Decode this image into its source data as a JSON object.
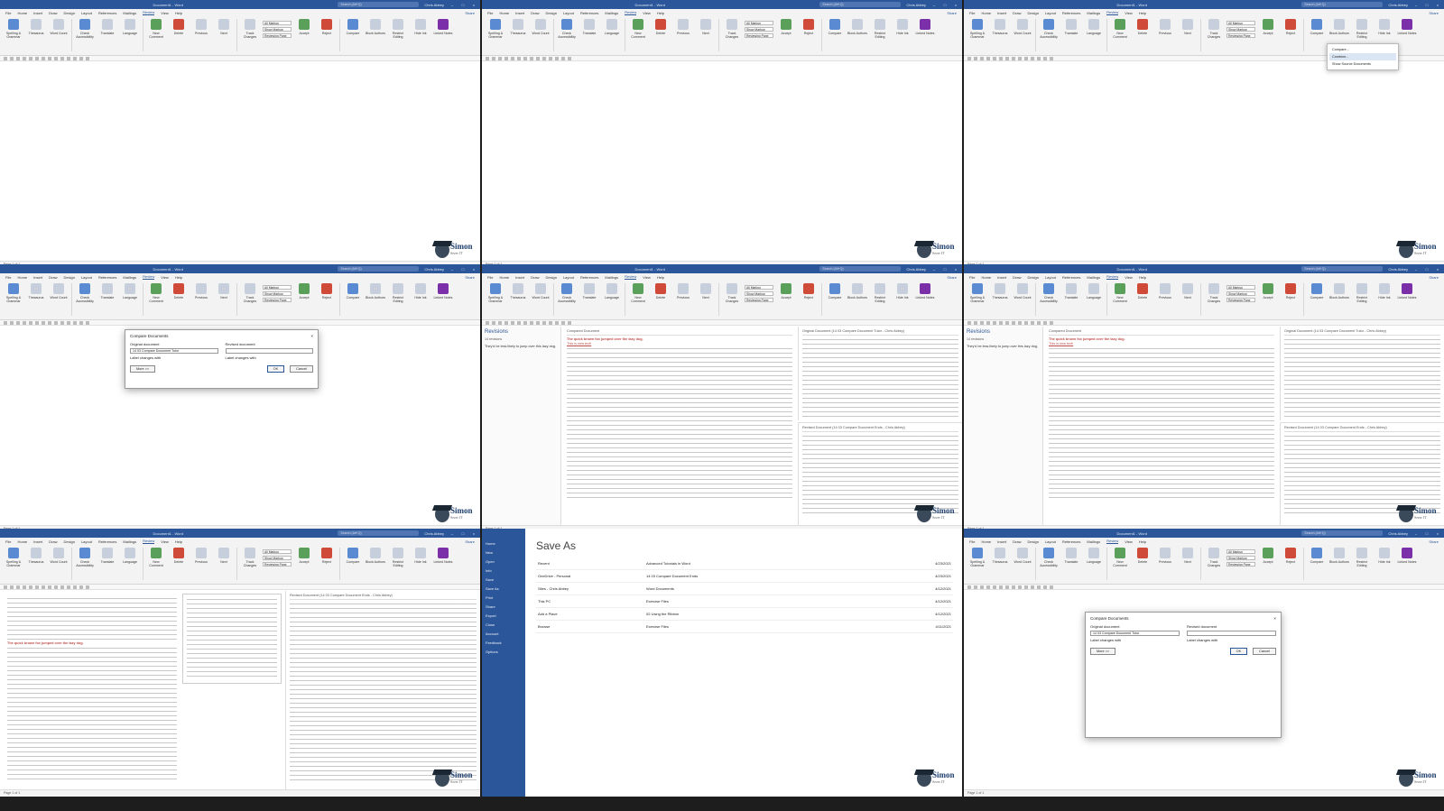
{
  "app": {
    "title": "Word",
    "doc_title": "Document1 - Word",
    "search_placeholder": "Search (Alt+Q)",
    "user": "Chris Abbey",
    "share_label": "Share",
    "brand_color": "#2b579a",
    "status": "Page 1 of 1",
    "menu": [
      "File",
      "Home",
      "Insert",
      "Draw",
      "Design",
      "Layout",
      "References",
      "Mailings",
      "Review",
      "View",
      "Help"
    ],
    "active_tab": "Review"
  },
  "ribbon": {
    "buttons": [
      {
        "label": "Spelling & Grammar",
        "icon": "spelling-icon",
        "tone": "blue"
      },
      {
        "label": "Thesaurus",
        "icon": "thesaurus-icon",
        "tone": ""
      },
      {
        "label": "Word Count",
        "icon": "word-count-icon",
        "tone": ""
      },
      {
        "label": "Check Accessibility",
        "icon": "accessibility-icon",
        "tone": "blue"
      },
      {
        "label": "Translate",
        "icon": "translate-icon",
        "tone": ""
      },
      {
        "label": "Language",
        "icon": "language-icon",
        "tone": ""
      },
      {
        "label": "New Comment",
        "icon": "new-comment-icon",
        "tone": "green"
      },
      {
        "label": "Delete",
        "icon": "delete-icon",
        "tone": "red"
      },
      {
        "label": "Previous",
        "icon": "previous-icon",
        "tone": ""
      },
      {
        "label": "Next",
        "icon": "next-icon",
        "tone": ""
      },
      {
        "label": "Track Changes",
        "icon": "track-changes-icon",
        "tone": ""
      },
      {
        "label": "Accept",
        "icon": "accept-icon",
        "tone": "green"
      },
      {
        "label": "Reject",
        "icon": "reject-icon",
        "tone": "red"
      },
      {
        "label": "Compare",
        "icon": "compare-icon",
        "tone": "blue"
      },
      {
        "label": "Block Authors",
        "icon": "block-authors-icon",
        "tone": ""
      },
      {
        "label": "Restrict Editing",
        "icon": "restrict-editing-icon",
        "tone": ""
      },
      {
        "label": "Hide Ink",
        "icon": "hide-ink-icon",
        "tone": ""
      },
      {
        "label": "Linked Notes",
        "icon": "onenote-icon",
        "tone": "purple"
      }
    ],
    "markup_dropdowns": [
      "All Markup",
      "Show Markup",
      "Reviewing Pane"
    ]
  },
  "compare_dialog": {
    "title": "Compare Documents",
    "original_label": "Original document",
    "original_value": "14 03 Compare Document Tutor",
    "revised_label": "Revised document",
    "revised_value": "",
    "label_changes_with": "Label changes with",
    "more_label": "More >>",
    "ok_label": "OK",
    "cancel_label": "Cancel"
  },
  "compare_dropdown": {
    "items": [
      "Compare...",
      "Combine...",
      "Show Source Documents"
    ]
  },
  "revisions_pane": {
    "title": "Revisions",
    "count": "14 revisions",
    "text": "They'd be less likely to jump over this lazy dog."
  },
  "doc": {
    "heading": "The quick brown fox jumped over the lazy dog.",
    "new_text": "This is new text!",
    "panel_compared": "Compared Document",
    "panel_original": "Original Document (14 03 Compare Document Tutor - Chris Abbey)",
    "panel_revised": "Revised Document (14 03 Compare Document Ends - Chris Abbey)"
  },
  "save_as": {
    "title": "Save As",
    "side": [
      "Home",
      "New",
      "Open",
      "Info",
      "Save",
      "Save As",
      "Print",
      "Share",
      "Export",
      "Close",
      "Account",
      "Feedback",
      "Options"
    ],
    "locations": [
      "Recent",
      "OneDrive - Personal",
      "Sites - Chris Abbey",
      "This PC",
      "Add a Place",
      "Browse"
    ],
    "files": [
      {
        "name": "Advanced Tutorials in Word",
        "date": "4/23/2021"
      },
      {
        "name": "14 03 Compare Document Ends",
        "date": "4/23/2021"
      },
      {
        "name": "Word Documents",
        "date": "4/12/2021"
      },
      {
        "name": "Exercise Files",
        "date": "4/12/2021"
      },
      {
        "name": "02 Using the Ribbon",
        "date": "4/12/2021"
      },
      {
        "name": "Exercise Files",
        "date": "4/11/2021"
      }
    ]
  },
  "logo": {
    "name": "Simon",
    "sub": "Sezer IT"
  }
}
